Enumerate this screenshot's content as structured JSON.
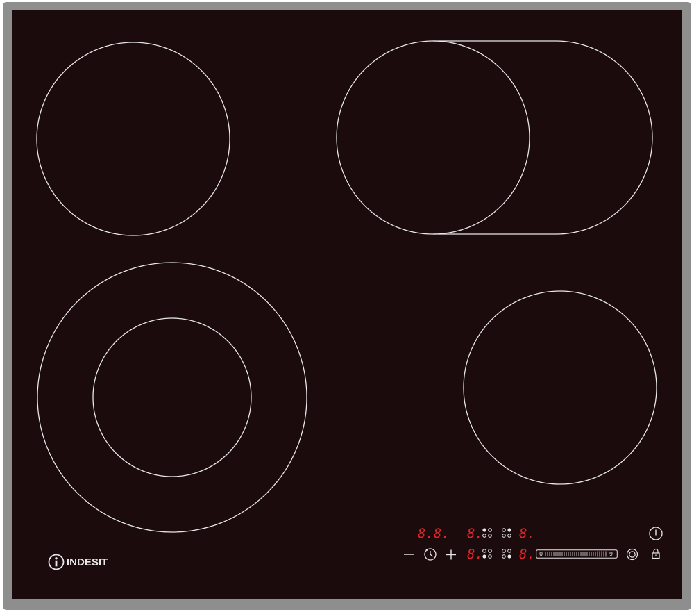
{
  "brand": {
    "name": "INDESIT",
    "icon": "info-i-circle-icon"
  },
  "displays": {
    "timer": "8.8.",
    "zone_top_left": "8.",
    "zone_top_right": "8.",
    "zone_bottom_left": "8.",
    "zone_bottom_right": "8."
  },
  "controls": {
    "minus_label": "−",
    "plus_label": "+",
    "slider_min": "0",
    "slider_max": "9",
    "timer_icon": "timer-clock-icon",
    "power_icon": "power-icon",
    "lock_icon": "lock-icon",
    "dual_zone_icon": "dual-zone-icon"
  },
  "colors": {
    "glass": "#1b0b0c",
    "frame": "#8e8e8e",
    "zone_outline": "#e8e8e8",
    "display_red": "#e0262c"
  }
}
